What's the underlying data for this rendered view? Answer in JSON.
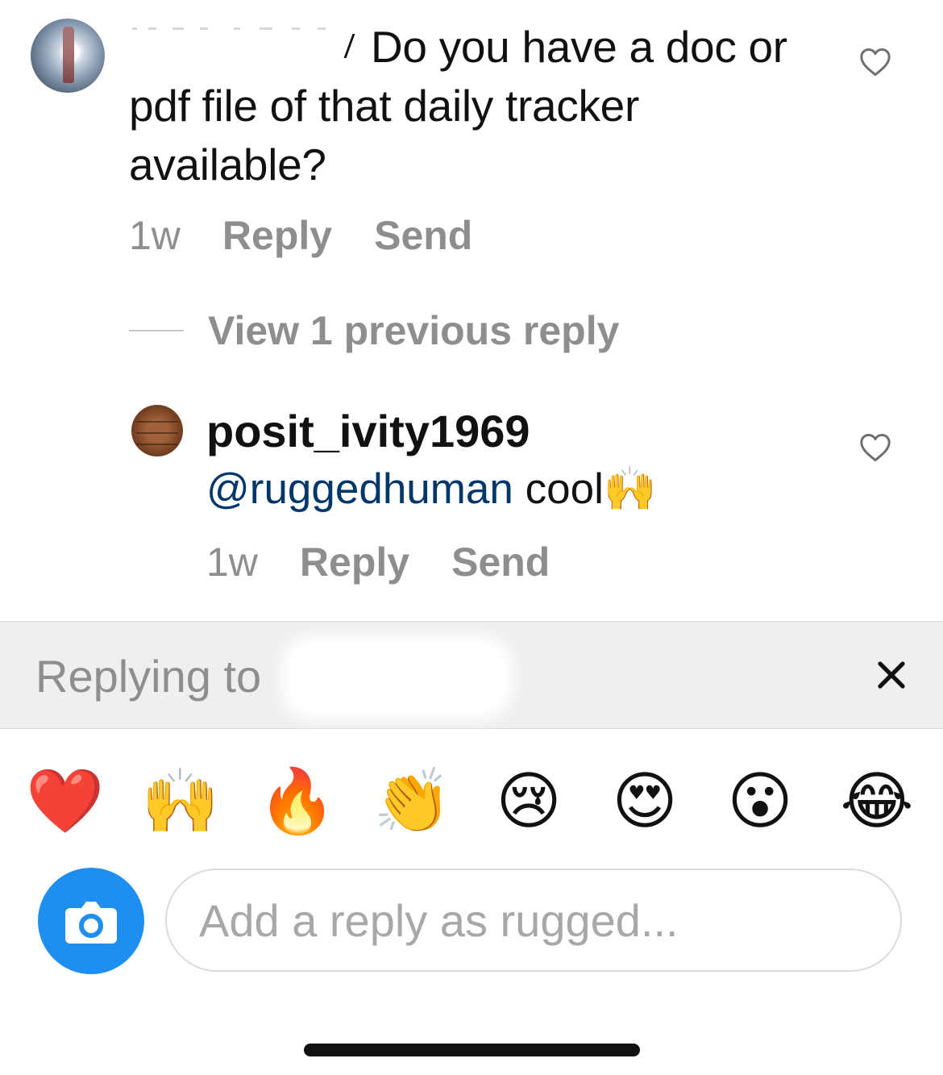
{
  "comment": {
    "text": "Do you have a doc or pdf file of that daily tracker available?",
    "time": "1w",
    "reply_label": "Reply",
    "send_label": "Send"
  },
  "view_replies": {
    "label": "View 1 previous reply"
  },
  "reply": {
    "username": "posit_ivity1969",
    "mention": "@ruggedhuman",
    "text": " cool🙌",
    "time": "1w",
    "reply_label": "Reply",
    "send_label": "Send"
  },
  "replying_bar": {
    "label": "Replying to"
  },
  "emoji_bar": [
    {
      "name": "red-heart",
      "char": "❤️"
    },
    {
      "name": "raising-hands",
      "char": "🙌"
    },
    {
      "name": "fire",
      "char": "🔥"
    },
    {
      "name": "clapping-hands",
      "char": "👏"
    },
    {
      "name": "crying-face",
      "char": "😢"
    },
    {
      "name": "heart-eyes",
      "char": "😍"
    },
    {
      "name": "surprised-face",
      "char": "😮"
    },
    {
      "name": "tears-of-joy",
      "char": "😂"
    }
  ],
  "composer": {
    "placeholder": "Add a reply as rugged..."
  },
  "colors": {
    "mention": "#00376b",
    "camera_button": "#1e8ef0",
    "meta_gray": "#8e8e8e"
  },
  "icons": {
    "like": "heart-outline-icon",
    "close": "close-icon",
    "camera": "camera-icon"
  }
}
